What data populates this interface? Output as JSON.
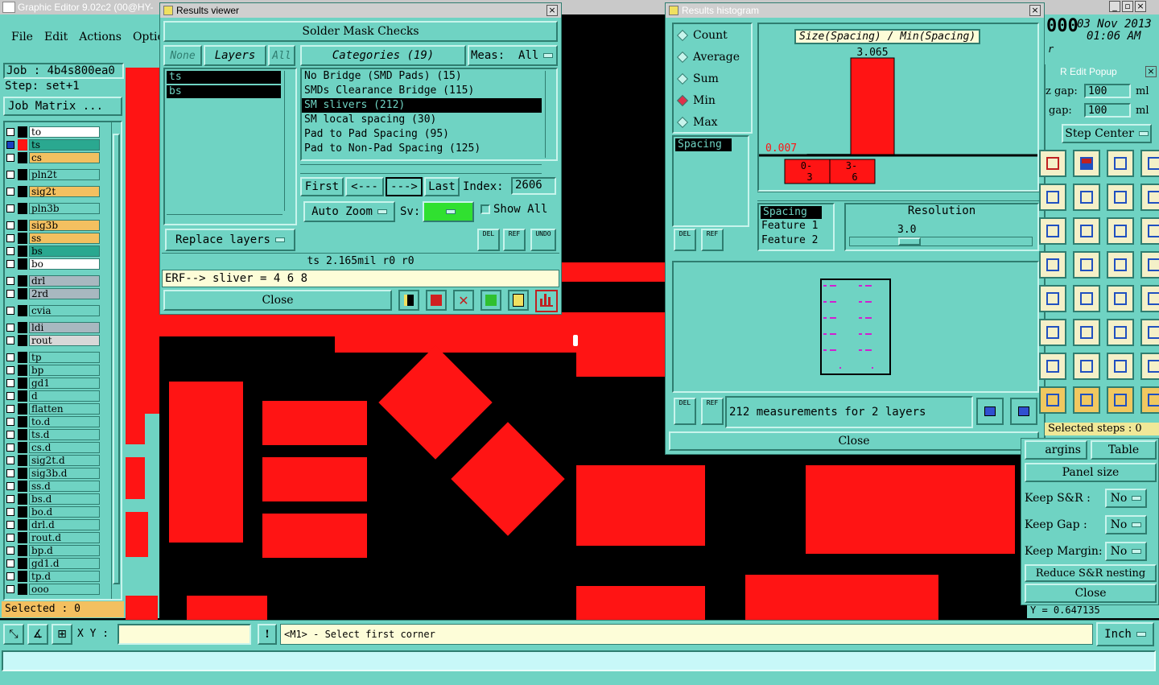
{
  "main_window": {
    "title": "Graphic Editor 9.02c2 (00@HY-",
    "date": "03 Nov 2013",
    "time": "01:06 AM",
    "partial_digits": "000",
    "partial_sub": "r",
    "menus": [
      "File",
      "Edit",
      "Actions",
      "Optio"
    ],
    "job_label": "Job : 4b4s800ea0",
    "step_label": "Step: set+1",
    "job_matrix_button": "Job Matrix ...",
    "selected_label": "Selected : 0",
    "xy_label": "X Y :",
    "xy_value": "",
    "status_message": "<M1> - Select first corner",
    "units": "Inch",
    "coords_partial": "Y = 0.647135"
  },
  "layers": [
    {
      "name": "to",
      "color": "#ffffff",
      "active": false
    },
    {
      "name": "ts",
      "color": "#2aa890",
      "active": true
    },
    {
      "name": "cs",
      "color": "#f3c060",
      "active": false
    },
    {
      "name": "pln2t",
      "color": "#6fd3c3",
      "active": false
    },
    {
      "name": "sig2t",
      "color": "#f3c060",
      "active": false
    },
    {
      "name": "pln3b",
      "color": "#6fd3c3",
      "active": false
    },
    {
      "name": "sig3b",
      "color": "#f3c060",
      "active": false
    },
    {
      "name": "ss",
      "color": "#f3c060",
      "active": false
    },
    {
      "name": "bs",
      "color": "#2aa890",
      "active": false
    },
    {
      "name": "bo",
      "color": "#ffffff",
      "active": false
    },
    {
      "name": "drl",
      "color": "#a8b8c0",
      "active": false
    },
    {
      "name": "2rd",
      "color": "#a8b8c0",
      "active": false
    },
    {
      "name": "cvia",
      "color": "#6fd3c3",
      "active": false
    },
    {
      "name": "ldi",
      "color": "#a8b8c0",
      "active": false
    },
    {
      "name": "rout",
      "color": "#d8d8d8",
      "active": false
    },
    {
      "name": "tp",
      "color": "#6fd3c3",
      "active": false
    },
    {
      "name": "bp",
      "color": "#6fd3c3",
      "active": false
    },
    {
      "name": "gd1",
      "color": "#6fd3c3",
      "active": false
    },
    {
      "name": "d",
      "color": "#6fd3c3",
      "active": false
    },
    {
      "name": "flatten",
      "color": "#6fd3c3",
      "active": false
    },
    {
      "name": "to.d",
      "color": "#6fd3c3",
      "active": false
    },
    {
      "name": "ts.d",
      "color": "#6fd3c3",
      "active": false
    },
    {
      "name": "cs.d",
      "color": "#6fd3c3",
      "active": false
    },
    {
      "name": "sig2t.d",
      "color": "#6fd3c3",
      "active": false
    },
    {
      "name": "sig3b.d",
      "color": "#6fd3c3",
      "active": false
    },
    {
      "name": "ss.d",
      "color": "#6fd3c3",
      "active": false
    },
    {
      "name": "bs.d",
      "color": "#6fd3c3",
      "active": false
    },
    {
      "name": "bo.d",
      "color": "#6fd3c3",
      "active": false
    },
    {
      "name": "drl.d",
      "color": "#6fd3c3",
      "active": false
    },
    {
      "name": "rout.d",
      "color": "#6fd3c3",
      "active": false
    },
    {
      "name": "bp.d",
      "color": "#6fd3c3",
      "active": false
    },
    {
      "name": "gd1.d",
      "color": "#6fd3c3",
      "active": false
    },
    {
      "name": "tp.d",
      "color": "#6fd3c3",
      "active": false
    },
    {
      "name": "ooo",
      "color": "#6fd3c3",
      "active": false
    }
  ],
  "results_viewer": {
    "title": "Results viewer",
    "header": "Solder Mask Checks",
    "none_button": "None",
    "layers_button": "Layers",
    "all_button": "All",
    "layers": [
      "ts",
      "bs"
    ],
    "categories_button": "Categories (19)",
    "meas_label": "Meas:",
    "meas_value": "All",
    "categories": [
      "No Bridge (SMD Pads) (15)",
      "SMDs Clearance Bridge (115)",
      "SM slivers (212)",
      "SM local spacing (30)",
      "Pad to Pad Spacing (95)",
      "Pad to Non-Pad Spacing (125)"
    ],
    "selected_category": 2,
    "first_button": "First",
    "prev_button": "<---",
    "next_button": "--->",
    "last_button": "Last",
    "index_label": "Index:",
    "index_value": "2606",
    "auto_zoom": "Auto Zoom",
    "sv_label": "Sv:",
    "show_all": "Show All",
    "replace_layers": "Replace layers",
    "del_icon": "DEL",
    "ref_icon": "REF",
    "undo_icon": "UNDO",
    "info_line": "ts 2.165mil  r0  r0",
    "erf_line": "ERF--> sliver = 4 6 8",
    "close_button": "Close"
  },
  "histogram": {
    "title": "Results histogram",
    "modes": [
      "Count",
      "Average",
      "Sum",
      "Min",
      "Max"
    ],
    "selected_mode": "Min",
    "measure_list": [
      "Spacing"
    ],
    "chart_title": "Size(Spacing) / Min(Spacing)",
    "del_icon": "DEL",
    "ref_icon": "REF",
    "features": [
      "Spacing",
      "Feature 1",
      "Feature 2"
    ],
    "resolution_label": "Resolution",
    "resolution_value": "3.0",
    "summary": "212 measurements for 2 layers",
    "close_button": "Close"
  },
  "chart_data": {
    "type": "bar",
    "title": "Size(Spacing) / Min(Spacing)",
    "categories": [
      "0-3",
      "3-6"
    ],
    "values": [
      0.007,
      3.065
    ],
    "data_labels": [
      "0.007",
      "3.065"
    ],
    "category_labels": [
      [
        "0-",
        "3"
      ],
      [
        "3-",
        "6"
      ]
    ]
  },
  "sr_popup": {
    "title": "R Edit Popup",
    "gap_x_label": "z gap:",
    "gap_x_value": "100",
    "gap_y_label": "gap:",
    "gap_y_value": "100",
    "unit": "ml",
    "step_center": "Step Center",
    "selected_steps": "Selected steps : 0",
    "margins_button": "argins",
    "table_button": "Table",
    "panel_size_button": "Panel size",
    "keep_sr_label": "Keep S&R   :",
    "keep_sr_value": "No",
    "keep_gap_label": "Keep Gap    :",
    "keep_gap_value": "No",
    "keep_margin_label": "Keep Margin:",
    "keep_margin_value": "No",
    "reduce_button": "Reduce S&R nesting",
    "close_button": "Close"
  },
  "colors": {
    "panel": "#6fd3c3",
    "copper": "#ff1414",
    "background": "#000000",
    "highlight_bar": "#ff1414"
  }
}
